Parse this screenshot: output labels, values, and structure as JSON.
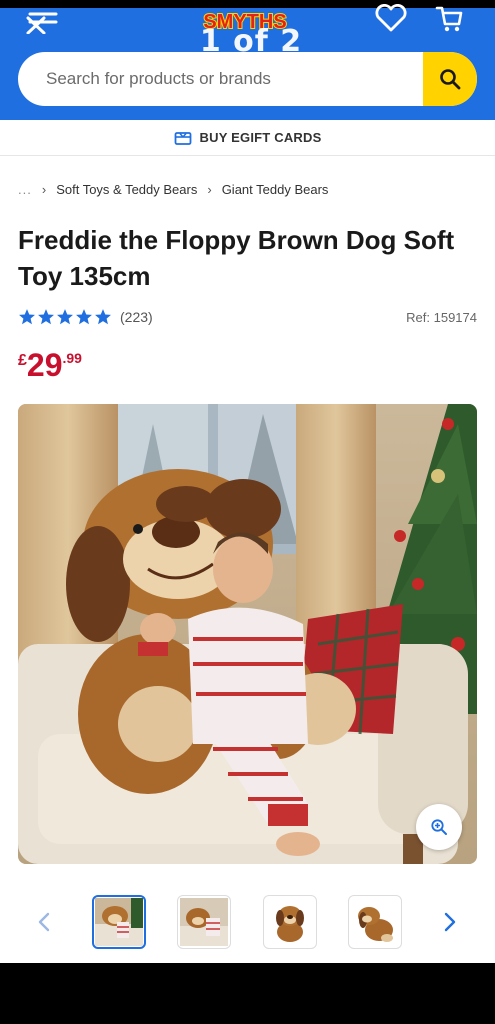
{
  "header": {
    "logo_text": "SMYTHS",
    "pager_text": "1 of 2",
    "search_placeholder": "Search for products or brands"
  },
  "egift": {
    "label": "BUY EGIFT CARDS"
  },
  "breadcrumb": {
    "ellipsis": "...",
    "items": [
      "Soft Toys & Teddy Bears",
      "Giant Teddy Bears"
    ]
  },
  "product": {
    "title": "Freddie the Floppy Brown Dog Soft Toy 135cm",
    "rating": 5,
    "review_count": "(223)",
    "ref": "Ref: 159174",
    "price_currency": "£",
    "price_int": "29",
    "price_dec": ".99"
  },
  "gallery": {
    "thumbnail_count": 4,
    "active_index": 0
  },
  "colors": {
    "brand_blue": "#1f6fe0",
    "search_yellow": "#ffd200",
    "price_red": "#c8102e",
    "star_blue": "#1f6fe0"
  }
}
